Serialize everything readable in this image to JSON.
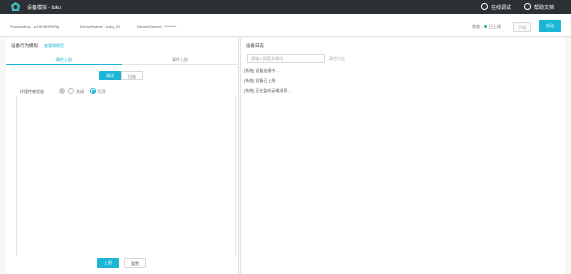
{
  "topbar": {
    "title": "设备模拟 - tuku",
    "debug_label": "在线调试",
    "help_label": "帮助文档"
  },
  "infobar": {
    "product_key": "ProductKey : a1SH9hPhPkj",
    "device_name": "DeviceName : tuku_01",
    "device_secret": "DeviceSecret : ********",
    "status_label": "状态 :",
    "status_value": "已上线",
    "offline_button": "下线",
    "start_button": "启动"
  },
  "left_panel": {
    "title": "设备行为模拟",
    "link": "查看物模型",
    "tabs": [
      "属性上报",
      "事件上报"
    ],
    "segments": [
      "调试",
      "日志"
    ],
    "field_label": "环境传感状态",
    "radio_options": [
      "关闭",
      "打开"
    ],
    "send_button": "上报",
    "reset_button": "重置"
  },
  "right_panel": {
    "title": "设备日志",
    "search_placeholder": "请输入搜索关键词",
    "clear_label": "清空日志",
    "logs": [
      "[系统] 设备连接中...",
      "[系统] 设备已上线",
      "[系统] 正在监听云端消息..."
    ]
  },
  "colors": {
    "accent": "#1bb6d6",
    "topbar_bg": "#2c3035",
    "online": "#2ab07e"
  }
}
